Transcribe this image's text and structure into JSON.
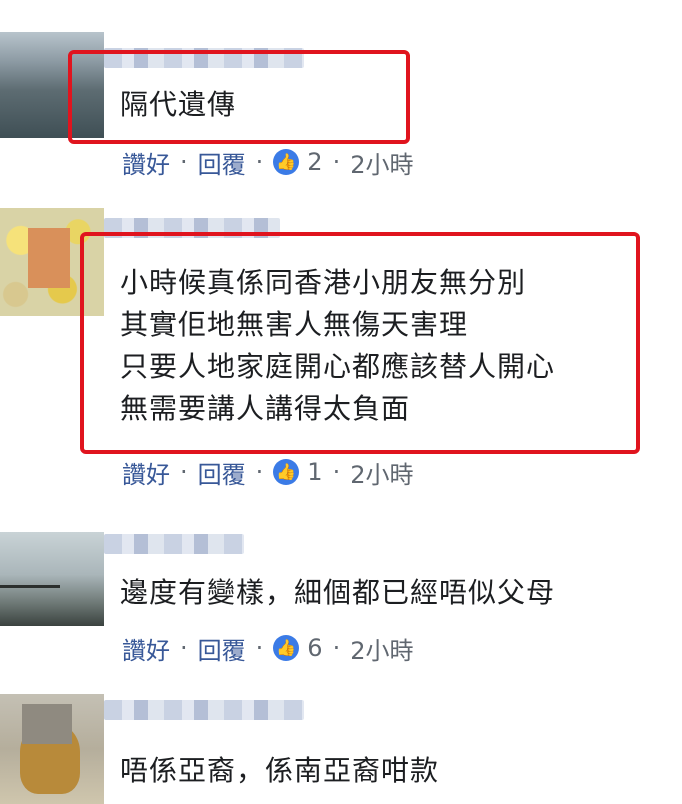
{
  "comments": [
    {
      "lines": [
        "隔代遺傳"
      ],
      "actions": {
        "like": "讚好",
        "reply": "回覆",
        "sep": "·",
        "reactions": "2",
        "time": "2小時"
      }
    },
    {
      "lines": [
        "小時候真係同香港小朋友無分別",
        "其實佢地無害人無傷天害理",
        "只要人地家庭開心都應該替人開心",
        "無需要講人講得太負面"
      ],
      "actions": {
        "like": "讚好",
        "reply": "回覆",
        "sep": "·",
        "reactions": "1",
        "time": "2小時"
      }
    },
    {
      "lines": [
        "邊度有變樣，細個都已經唔似父母"
      ],
      "actions": {
        "like": "讚好",
        "reply": "回覆",
        "sep": "·",
        "reactions": "6",
        "time": "2小時"
      }
    },
    {
      "lines": [
        "唔係亞裔，係南亞裔咁款"
      ]
    }
  ],
  "icons": {
    "like_reaction": "thumbs-up-icon"
  },
  "colors": {
    "link": "#385898",
    "meta_gray": "#606770",
    "highlight_box": "#e0141e",
    "reaction_blue": "#3b7be6"
  }
}
